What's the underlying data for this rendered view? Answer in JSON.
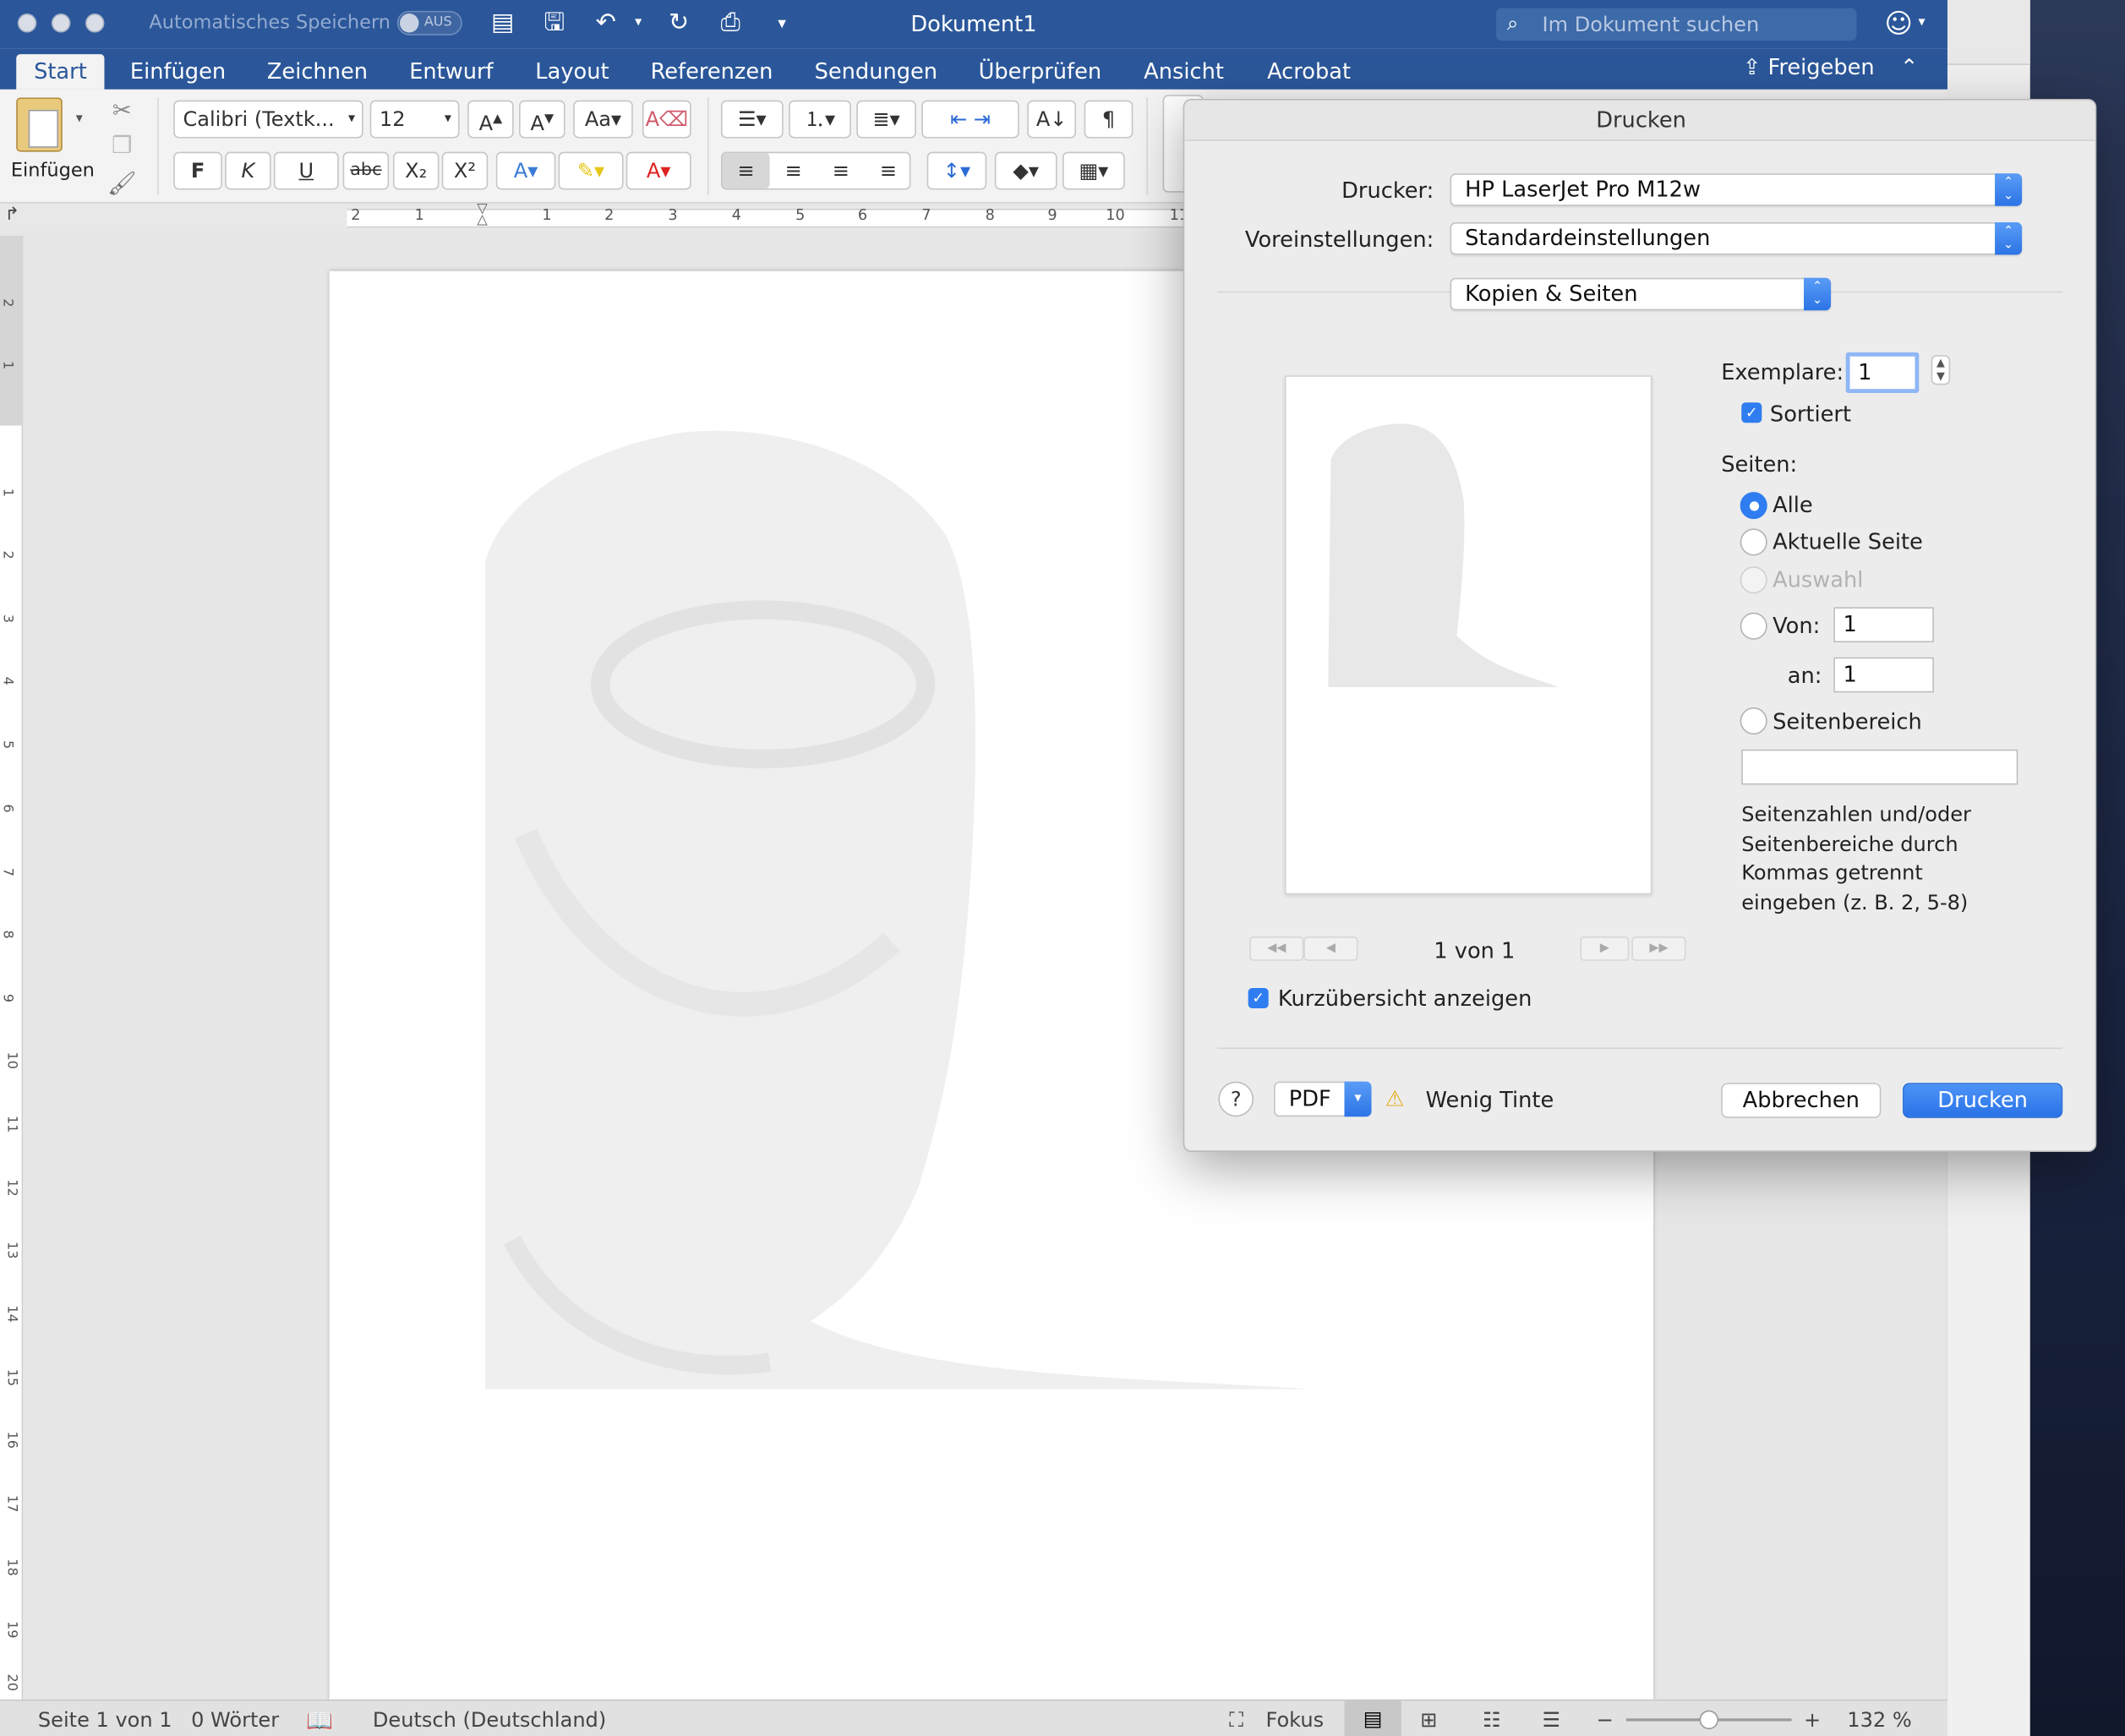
{
  "titlebar": {
    "autosave_label": "Automatisches Speichern",
    "autosave_state": "AUS",
    "document_title": "Dokument1",
    "search_placeholder": "Im Dokument suchen"
  },
  "menu": {
    "tabs": [
      "Start",
      "Einfügen",
      "Zeichnen",
      "Entwurf",
      "Layout",
      "Referenzen",
      "Sendungen",
      "Überprüfen",
      "Ansicht",
      "Acrobat"
    ],
    "active_tab": "Start",
    "share_label": "Freigeben"
  },
  "ribbon": {
    "paste_label": "Einfügen",
    "font_name": "Calibri (Textk...",
    "font_size": "12",
    "bold": "F",
    "italic": "K",
    "underline": "U",
    "strikethrough": "abc"
  },
  "ruler": {
    "h_left": [
      "2",
      "1"
    ],
    "h_right": [
      "1",
      "2",
      "3",
      "4",
      "5",
      "6",
      "7",
      "8",
      "9",
      "10",
      "11"
    ],
    "v": [
      "2",
      "1",
      "1",
      "2",
      "3",
      "4",
      "5",
      "6",
      "7",
      "8",
      "9",
      "10",
      "11",
      "12",
      "13",
      "14",
      "15",
      "16",
      "17",
      "18",
      "19",
      "20"
    ]
  },
  "status": {
    "page": "Seite 1 von 1",
    "words": "0 Wörter",
    "language": "Deutsch (Deutschland)",
    "focus": "Fokus",
    "zoom": "132 %",
    "zoom_level": 0.5
  },
  "dialog": {
    "title": "Drucken",
    "printer_label": "Drucker:",
    "printer_value": "HP LaserJet Pro M12w",
    "presets_label": "Voreinstellungen:",
    "presets_value": "Standardeinstellungen",
    "section_value": "Kopien & Seiten",
    "copies_label": "Exemplare:",
    "copies_value": "1",
    "collated_label": "Sortiert",
    "collated": true,
    "pages_label": "Seiten:",
    "options": {
      "all": "Alle",
      "current": "Aktuelle Seite",
      "selection": "Auswahl",
      "from": "Von:",
      "range": "Seitenbereich"
    },
    "selected_option": "Alle",
    "from_value": "1",
    "to_label": "an:",
    "to_value": "1",
    "range_value": "",
    "range_hint": [
      "Seitenzahlen und/oder",
      "Seitenbereiche durch",
      "Kommas getrennt",
      "eingeben (z. B. 2, 5-8)"
    ],
    "page_indicator": "1 von 1",
    "show_details_label": "Kurzübersicht anzeigen",
    "show_details": true,
    "help_label": "?",
    "pdf_label": "PDF",
    "warning_text": "Wenig Tinte",
    "cancel_label": "Abbrechen",
    "print_label": "Drucken",
    "accent": "#2f7df0"
  }
}
